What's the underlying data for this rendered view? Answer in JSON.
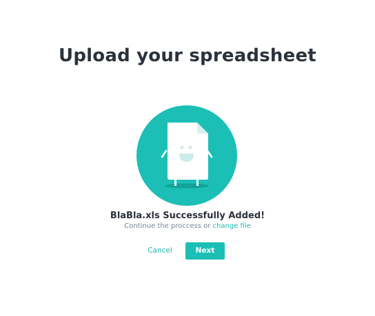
{
  "header": {
    "title": "Upload your spreadsheet"
  },
  "status": {
    "heading": "BlaBla.xls Successfully Added!",
    "message_prefix": "Continue the proccess or",
    "change_file_link": "change file"
  },
  "actions": {
    "cancel_label": "Cancel",
    "next_label": "Next"
  },
  "colors": {
    "accent": "#1bbfb5",
    "heading": "#2c323b",
    "muted": "#7b8591"
  },
  "icons": {
    "illustration": "happy-file-icon"
  }
}
